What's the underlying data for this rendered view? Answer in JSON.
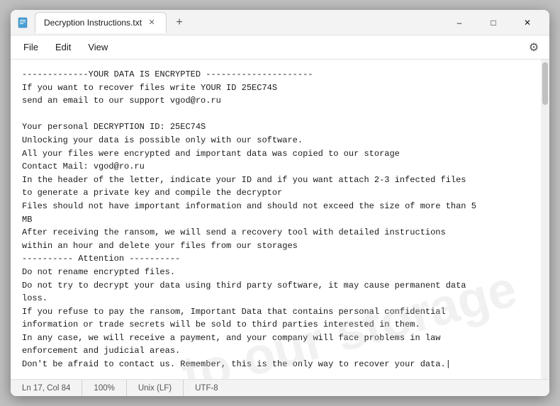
{
  "window": {
    "title": "Decryption Instructions.txt",
    "icon": "document"
  },
  "tabs": {
    "active": "Decryption Instructions.txt",
    "new_tab_label": "+"
  },
  "window_controls": {
    "minimize": "–",
    "maximize": "□",
    "close": "✕"
  },
  "menubar": {
    "file": "File",
    "edit": "Edit",
    "view": "View",
    "gear": "⚙"
  },
  "content": {
    "text": "-------------YOUR DATA IS ENCRYPTED ---------------------\nIf you want to recover files write YOUR ID 25EC74S\nsend an email to our support vgod@ro.ru\n\nYour personal DECRYPTION ID: 25EC74S\nUnlocking your data is possible only with our software.\nAll your files were encrypted and important data was copied to our storage\nContact Mail: vgod@ro.ru\nIn the header of the letter, indicate your ID and if you want attach 2-3 infected files\nto generate a private key and compile the decryptor\nFiles should not have important information and should not exceed the size of more than 5\nMB\nAfter receiving the ransom, we will send a recovery tool with detailed instructions\nwithin an hour and delete your files from our storages\n---------- Attention ----------\nDo not rename encrypted files.\nDo not try to decrypt your data using third party software, it may cause permanent data\nloss.\nIf you refuse to pay the ransom, Important Data that contains personal confidential\ninformation or trade secrets will be sold to third parties interested in them.\nIn any case, we will receive a payment, and your company will face problems in law\nenforcement and judicial areas.\nDon't be afraid to contact us. Remember, this is the only way to recover your data.|"
  },
  "statusbar": {
    "position": "Ln 17, Col 84",
    "zoom": "100%",
    "line_ending": "Unix (LF)",
    "encoding": "UTF-8"
  },
  "watermark": {
    "line1": "to our storage"
  }
}
